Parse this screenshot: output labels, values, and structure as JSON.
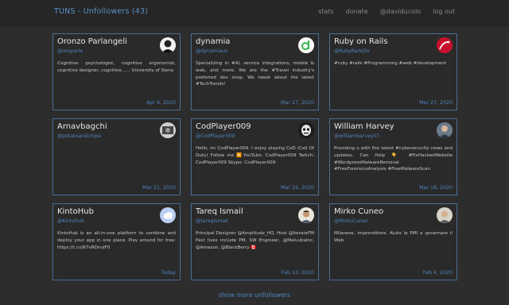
{
  "header": {
    "title": "TUNS - Unfollowers (43)",
    "nav": [
      "stats",
      "donate",
      "@daviducolo",
      "log out"
    ]
  },
  "cards": [
    {
      "name": "Oronzo Parlangeli",
      "handle": "@oroparla",
      "bio": "Cognitive psychologist, cognitive ergonomist, cognitive designer, cognitive...... University of Siena",
      "date": "Apr 4, 2020",
      "avatar_icon": "person-portrait-icon"
    },
    {
      "name": "dynamia",
      "handle": "@dynamiaus",
      "bio": "Specializing in #AI, service integrations, mobile & web, and more. We are the #Travel industry's preferred dev shop. We tweet about the latest #TechTrends!",
      "date": "Mar 27, 2020",
      "avatar_icon": "dynamia-logo-icon"
    },
    {
      "name": "Ruby on Rails",
      "handle": "@RubyRailsDv",
      "bio": "#ruby #rails #Programming #web #development",
      "date": "Mar 27, 2020",
      "avatar_icon": "rails-logo-icon"
    },
    {
      "name": "Arnavbagchi",
      "handle": "@potatoandchipa",
      "bio": "",
      "date": "Mar 21, 2020",
      "avatar_icon": "person-portrait-icon"
    },
    {
      "name": "CodPlayer009",
      "handle": "@CodPlayer009",
      "bio": "Hello, im CodPlayer009. I enjoy playing CoD (Call Of Duty) Follow me ▶️YouTube: CodPlayer009 Twitch: CodPlayer009 Skype: CodPlayer009",
      "date": "Mar 19, 2020",
      "avatar_icon": "skull-mask-icon"
    },
    {
      "name": "William Harvey",
      "handle": "@williamharvey07",
      "bio": "Providing u with the latest #cybersecurity news and updates. Can Help 👇 #FixHackedWebsite #WordpressMalwareRemoval #FreeForensicsAnalysis #FreeMalwareScan",
      "date": "Mar 18, 2020",
      "avatar_icon": "person-portrait-icon"
    },
    {
      "name": "KintoHub",
      "handle": "@Kintohub",
      "bio": "KintoHub is an all-in-one platform to combine and deploy your app in one place. Play around for free: https://t.co/67vRDnulF0",
      "date": "Today",
      "avatar_icon": "cloud-logo-icon"
    },
    {
      "name": "Tareq Ismail",
      "handle": "@tareqismail",
      "bio": "Principal Designer @Amplitude_HQ. Host @IterateFM Past lives include PM, SW Engineer, @Maluubalnc, @Amazon, @BlackBerry 🇨🇦",
      "date": "Feb 13, 2020",
      "avatar_icon": "person-portrait-icon"
    },
    {
      "name": "Mirko Cuneo",
      "handle": "@MirkoCuneo",
      "bio": "Milanese, imprenditore. Aiuto la PMI a governare il Web",
      "date": "Feb 4, 2020",
      "avatar_icon": "person-portrait-icon"
    }
  ],
  "footer": {
    "more_label": "show more unfollowers"
  },
  "colors": {
    "background": "#2d2d2d",
    "accent": "#4f86bf",
    "card_border": "#4a6f96"
  }
}
